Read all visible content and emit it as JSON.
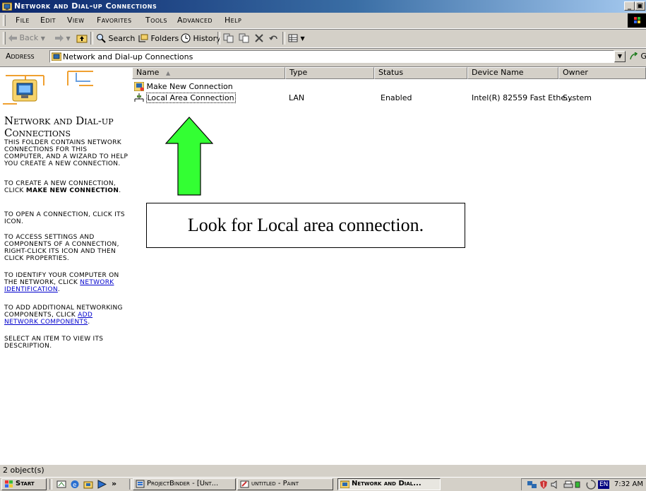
{
  "window": {
    "title": "Network and Dial-up Connections",
    "caption_buttons": {
      "minimize": "_",
      "restore": "▣",
      "close": "×"
    }
  },
  "menu": {
    "items": [
      "File",
      "Edit",
      "View",
      "Favorites",
      "Tools",
      "Advanced",
      "Help"
    ]
  },
  "toolbar": {
    "back": "Back",
    "search": "Search",
    "folders": "Folders",
    "history": "History"
  },
  "address": {
    "label": "Address",
    "value": "Network and Dial-up Connections",
    "go": "Go"
  },
  "left_pane": {
    "title": "Network and Dial-up Connections",
    "para1": "This folder contains network connections for this computer, and a wizard to help you create a new connection.",
    "para2_prefix": "To create a new connection, click ",
    "para2_bold": "Make New Connection",
    "para2_suffix": ".",
    "para3": "To open a connection, click its icon.",
    "para4": "To access settings and components of a connection, right-click its icon and then click Properties.",
    "para5_prefix": "To identify your computer on the network, click ",
    "para5_link": "Network Identification",
    "para5_suffix": ".",
    "para6_prefix": "To add additional networking components, click ",
    "para6_link": "Add Network Components",
    "para6_suffix": ".",
    "para7": "Select an item to view its description."
  },
  "list": {
    "columns": [
      "Name",
      "Type",
      "Status",
      "Device Name",
      "Owner"
    ],
    "rows": [
      {
        "name": "Make New Connection",
        "type": "",
        "status": "",
        "device": "",
        "owner": ""
      },
      {
        "name": "Local Area Connection",
        "type": "LAN",
        "status": "Enabled",
        "device": "Intel(R) 82559 Fast Ethe...",
        "owner": "System"
      }
    ]
  },
  "annotation": {
    "callout_text": "Look for Local area connection."
  },
  "status_bar": {
    "text": "2 object(s)"
  },
  "taskbar": {
    "start": "Start",
    "chevron": "»",
    "buttons": [
      "ProjectBinder - [Unt...",
      "untitled - Paint",
      "Network and Dial..."
    ],
    "tray_lang": "EN",
    "clock": "7:32 AM"
  },
  "colors": {
    "titlebar_start": "#0a246a",
    "titlebar_end": "#a6caf0",
    "face": "#d4d0c8",
    "arrow_green": "#33ff33",
    "link": "#0000cc"
  },
  "icons": [
    "network-folder-icon",
    "back-arrow-icon",
    "forward-arrow-icon",
    "up-folder-icon",
    "search-icon",
    "folders-icon",
    "history-icon",
    "move-to-icon",
    "copy-to-icon",
    "delete-icon",
    "undo-icon",
    "views-icon",
    "windows-logo-icon",
    "make-new-connection-icon",
    "lan-connection-icon",
    "start-logo-icon",
    "show-desktop-icon",
    "ie-icon",
    "explorer-icon",
    "media-icon"
  ]
}
